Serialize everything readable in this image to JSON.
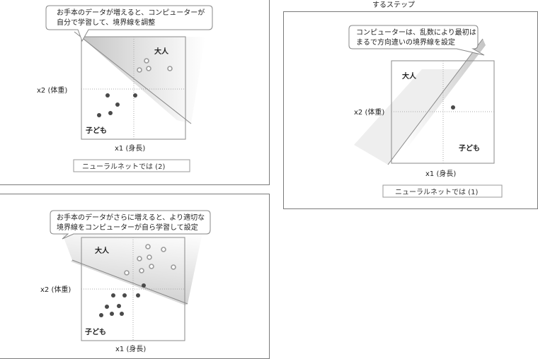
{
  "top_left": {
    "callout": [
      "お手本のデータが増えると、コンピューターが",
      "自分で学習して、境界線を調整"
    ],
    "class_adult": "大人",
    "class_child": "子ども",
    "axis_y": "x2 (体重)",
    "axis_x": "x1 (身長)",
    "caption": "ニューラルネットでは (2)"
  },
  "right": {
    "heading": "するステップ",
    "callout": [
      "コンピューターは、乱数により最初は",
      "まるで方向違いの境界線を設定"
    ],
    "class_adult": "大人",
    "class_child": "子ども",
    "axis_y": "x2 (体重)",
    "axis_x": "x1 (身長)",
    "caption": "ニューラルネットでは (1)"
  },
  "bottom_left": {
    "callout": [
      "お手本のデータがさらに増えると、より適切な",
      "境界線をコンピューターが自ら学習して設定"
    ],
    "class_adult": "大人",
    "class_child": "子ども",
    "axis_y": "x2 (体重)",
    "axis_x": "x1 (身長)"
  },
  "colors": {
    "border": "#7a7a7a",
    "dot": "#4a4a4a",
    "ring": "#9a9a9a",
    "shade": "#d6d6d6"
  }
}
